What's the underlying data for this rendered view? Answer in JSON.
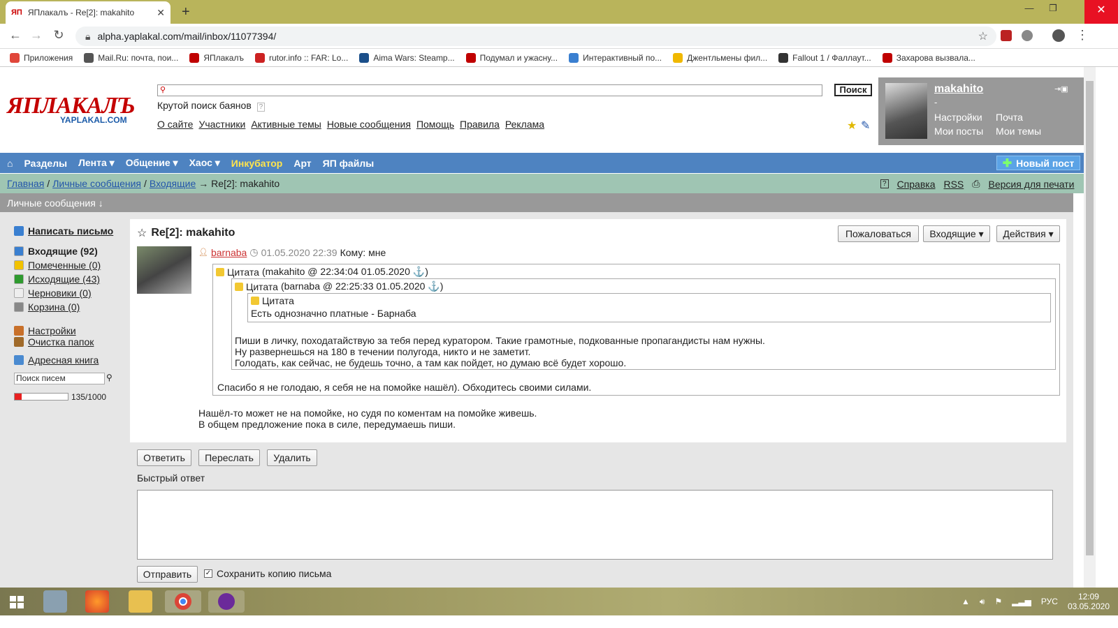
{
  "browser": {
    "tab_title": "ЯПлакалъ - Re[2]: makahito",
    "tab_icon": "ЯП",
    "url": "alpha.yaplakal.com/mail/inbox/11077394/",
    "bookmarks": [
      {
        "label": "Приложения",
        "color": "#e0463a"
      },
      {
        "label": "Mail.Ru: почта, пои...",
        "color": "#555555"
      },
      {
        "label": "ЯПлакалъ",
        "color": "#c00000"
      },
      {
        "label": "rutor.info :: FAR: Lo...",
        "color": "#cc2222"
      },
      {
        "label": "Aima Wars: Steamp...",
        "color": "#1b4f8a"
      },
      {
        "label": "Подумал и ужасну...",
        "color": "#c00000"
      },
      {
        "label": "Интерактивный по...",
        "color": "#3a7fd0"
      },
      {
        "label": "Джентльмены фил...",
        "color": "#f0b800"
      },
      {
        "label": "Fallout 1 / Фаллаут...",
        "color": "#333333"
      },
      {
        "label": "Захарова вызвала...",
        "color": "#c00000"
      }
    ]
  },
  "header": {
    "logo_main": "ЯПЛАКАЛЪ",
    "logo_sub": "YAPLAKAL.COM",
    "search_button": "Поиск",
    "search_hint": "Крутой поиск баянов",
    "nav": [
      "О сайте",
      "Участники",
      "Активные темы",
      "Новые сообщения",
      "Помощь",
      "Правила",
      "Реклама"
    ]
  },
  "user": {
    "name": "makahito",
    "status": "-",
    "links": [
      "Настройки",
      "Почта",
      "Мои посты",
      "Мои темы"
    ]
  },
  "mainnav": {
    "items": [
      "Разделы",
      "Лента ▾",
      "Общение ▾",
      "Хаос ▾",
      "Инкубатор",
      "Арт",
      "ЯП файлы"
    ],
    "new_post": "Новый пост"
  },
  "breadcrumbs": {
    "home": "Главная",
    "pm": "Личные сообщения",
    "inbox": "Входящие",
    "current": "→ Re[2]: makahito",
    "sep": "/",
    "help": "Справка",
    "rss": "RSS",
    "print": "Версия для печати"
  },
  "section_title": "Личные сообщения ↓",
  "sidebar": {
    "compose": "Написать письмо",
    "folders": [
      {
        "label": "Входящие (92)",
        "bold": true,
        "color": "#3a7fd0"
      },
      {
        "label": "Помеченные (0)",
        "color": "#f2c200"
      },
      {
        "label": "Исходящие (43)",
        "color": "#2e9a2e"
      },
      {
        "label": "Черновики (0)",
        "color": "#eeeeee"
      },
      {
        "label": "Корзина (0)",
        "color": "#888888"
      }
    ],
    "settings": "Настройки",
    "cleanup": "Очистка папок",
    "addressbook": "Адресная книга",
    "search_placeholder": "Поиск писем",
    "quota_percent": 13.5,
    "quota_text": "135/1000"
  },
  "message": {
    "title": "Re[2]: makahito",
    "buttons": {
      "report": "Пожаловаться",
      "folder": "Входящие ▾",
      "actions": "Действия ▾"
    },
    "sender": "barnaba",
    "date": "01.05.2020 22:39",
    "to": "Кому: мне",
    "quote_label": "Цитата",
    "q1_meta": "(makahito @ 22:34:04 01.05.2020 ⚓)",
    "q2_meta": "(barnaba @ 22:25:33 01.05.2020 ⚓)",
    "q3_text": "Есть однозначно платные - Барнаба",
    "q2_text": [
      "Пиши в личку, походатайствую за тебя перед куратором. Такие грамотные, подкованные пропагандисты нам нужны.",
      "Ну развернешься на 180 в течении полугода, никто и не заметит.",
      "Голодать, как сейчас, не будешь точно, а там как пойдет, но думаю всё будет хорошо."
    ],
    "q1_text": "Спасибо я не голодаю, я себя не на помойке нашёл). Обходитесь своими силами.",
    "reply_text": [
      "Нашёл-то может не на помойке, но судя по коментам на помойке живешь.",
      "В общем предложение пока в силе, передумаешь пиши."
    ]
  },
  "actions": {
    "reply": "Ответить",
    "forward": "Переслать",
    "delete": "Удалить"
  },
  "quick_reply": {
    "title": "Быстрый ответ",
    "send": "Отправить",
    "save_copy": "Сохранить копию письма"
  },
  "taskbar": {
    "lang": "РУС",
    "time": "12:09",
    "date": "03.05.2020"
  }
}
